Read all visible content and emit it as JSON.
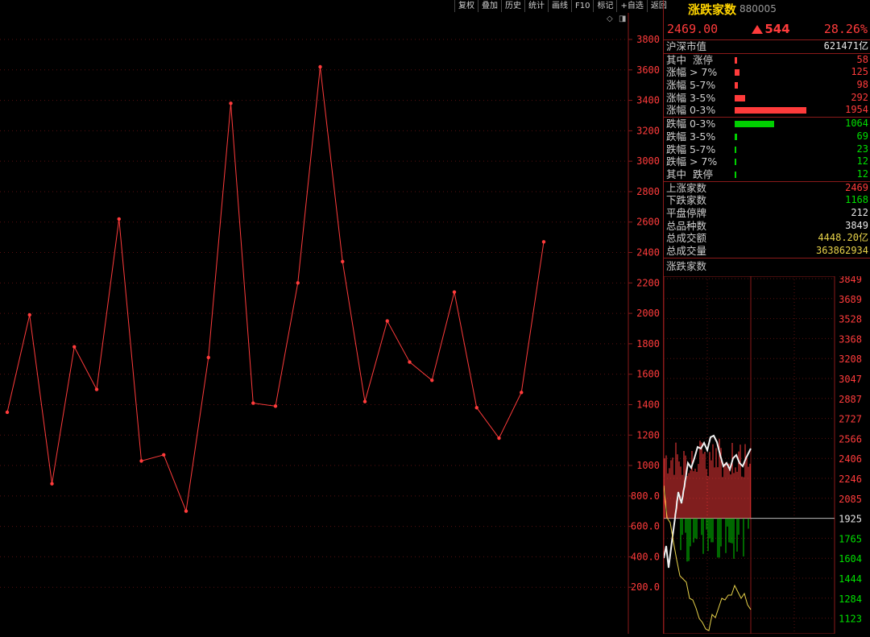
{
  "toolbar": {
    "buttons": [
      "复权",
      "叠加",
      "历史",
      "统计",
      "画线",
      "F10",
      "标记",
      "+自选",
      "返回"
    ]
  },
  "main_chart": {
    "corner_icons": [
      "diamond-icon",
      "window-icon"
    ],
    "y_labels": [
      "3800",
      "3600",
      "3400",
      "3200",
      "3000",
      "2800",
      "2600",
      "2400",
      "2200",
      "2000",
      "1800",
      "1600",
      "1400",
      "1200",
      "1000",
      "800.0",
      "600.0",
      "400.0",
      "200.0"
    ],
    "line_color": "#ff3b3b",
    "grid_color": "#5a1010"
  },
  "chart_data": {
    "type": "line",
    "series": [
      {
        "values": [
          1350,
          1990,
          880,
          1780,
          1500,
          2620,
          1030,
          1070,
          700,
          1710,
          3380,
          1410,
          1390,
          2200,
          3620,
          2340,
          1420,
          1950,
          1680,
          1560,
          2140,
          1380,
          1180,
          1480,
          2470
        ]
      }
    ],
    "ylim": [
      0,
      3900
    ]
  },
  "panel": {
    "title": "涨跌家数",
    "code": "880005",
    "price": "2469.00",
    "change": "544",
    "change_pct": "28.26%",
    "market_value_label": "沪深市值",
    "market_value": "621471亿",
    "up_rows": [
      {
        "label": "其中  涨停",
        "value": "58",
        "ratio": 0.03
      },
      {
        "label": "涨幅 > 7%",
        "value": "125",
        "ratio": 0.064
      },
      {
        "label": "涨幅 5-7%",
        "value": "98",
        "ratio": 0.05
      },
      {
        "label": "涨幅 3-5%",
        "value": "292",
        "ratio": 0.149
      },
      {
        "label": "涨幅 0-3%",
        "value": "1954",
        "ratio": 1.0
      }
    ],
    "down_rows": [
      {
        "label": "跌幅 0-3%",
        "value": "1064",
        "ratio": 0.545
      },
      {
        "label": "跌幅 3-5%",
        "value": "69",
        "ratio": 0.035
      },
      {
        "label": "跌幅 5-7%",
        "value": "23",
        "ratio": 0.012
      },
      {
        "label": "跌幅 > 7%",
        "value": "12",
        "ratio": 0.006
      },
      {
        "label": "其中  跌停",
        "value": "12",
        "ratio": 0.006
      }
    ],
    "stats": [
      {
        "label": "上涨家数",
        "value": "2469",
        "color": "#ff3b3b"
      },
      {
        "label": "下跌家数",
        "value": "1168",
        "color": "#00e000"
      },
      {
        "label": "平盘停牌",
        "value": "212",
        "color": "#e6e6e6"
      },
      {
        "label": "总品种数",
        "value": "3849",
        "color": "#e6e6e6"
      },
      {
        "label": "总成交额",
        "value": "4448.20亿",
        "color": "#e8d34a"
      },
      {
        "label": "总成交量",
        "value": "363862934",
        "color": "#e8d34a"
      }
    ],
    "mini_title": "涨跌家数",
    "mini_y_labels": [
      "3849",
      "3689",
      "3528",
      "3368",
      "3208",
      "3047",
      "2887",
      "2727",
      "2566",
      "2406",
      "2246",
      "2085",
      "1925",
      "1765",
      "1604",
      "1444",
      "1284",
      "1123"
    ]
  }
}
